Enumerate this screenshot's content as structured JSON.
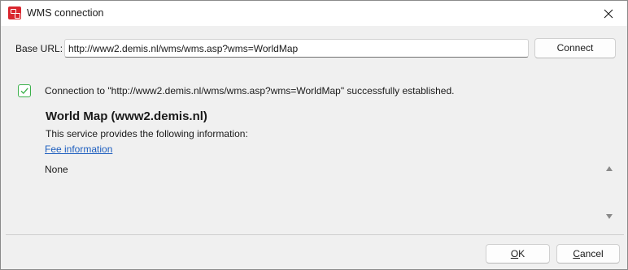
{
  "window": {
    "title": "WMS connection",
    "app_icon": "app-logo-icon",
    "close_icon": "close-icon"
  },
  "connection": {
    "url_label": "Base URL:",
    "url_value": "http://www2.demis.nl/wms/wms.asp?wms=WorldMap",
    "connect_label": "Connect"
  },
  "status": {
    "icon": "checkmark-icon",
    "message": "Connection to \"http://www2.demis.nl/wms/wms.asp?wms=WorldMap\" successfully established."
  },
  "service": {
    "title": "World Map (www2.demis.nl)",
    "description": "This service provides the following information:",
    "link_text": "Fee information",
    "info_text": "None"
  },
  "footer": {
    "ok_mnemonic": "O",
    "ok_rest": "K",
    "cancel_mnemonic": "C",
    "cancel_rest": "ancel"
  },
  "colors": {
    "accent_check": "#3bb04a",
    "link": "#1e5fbf",
    "app_icon": "#d9262e"
  }
}
